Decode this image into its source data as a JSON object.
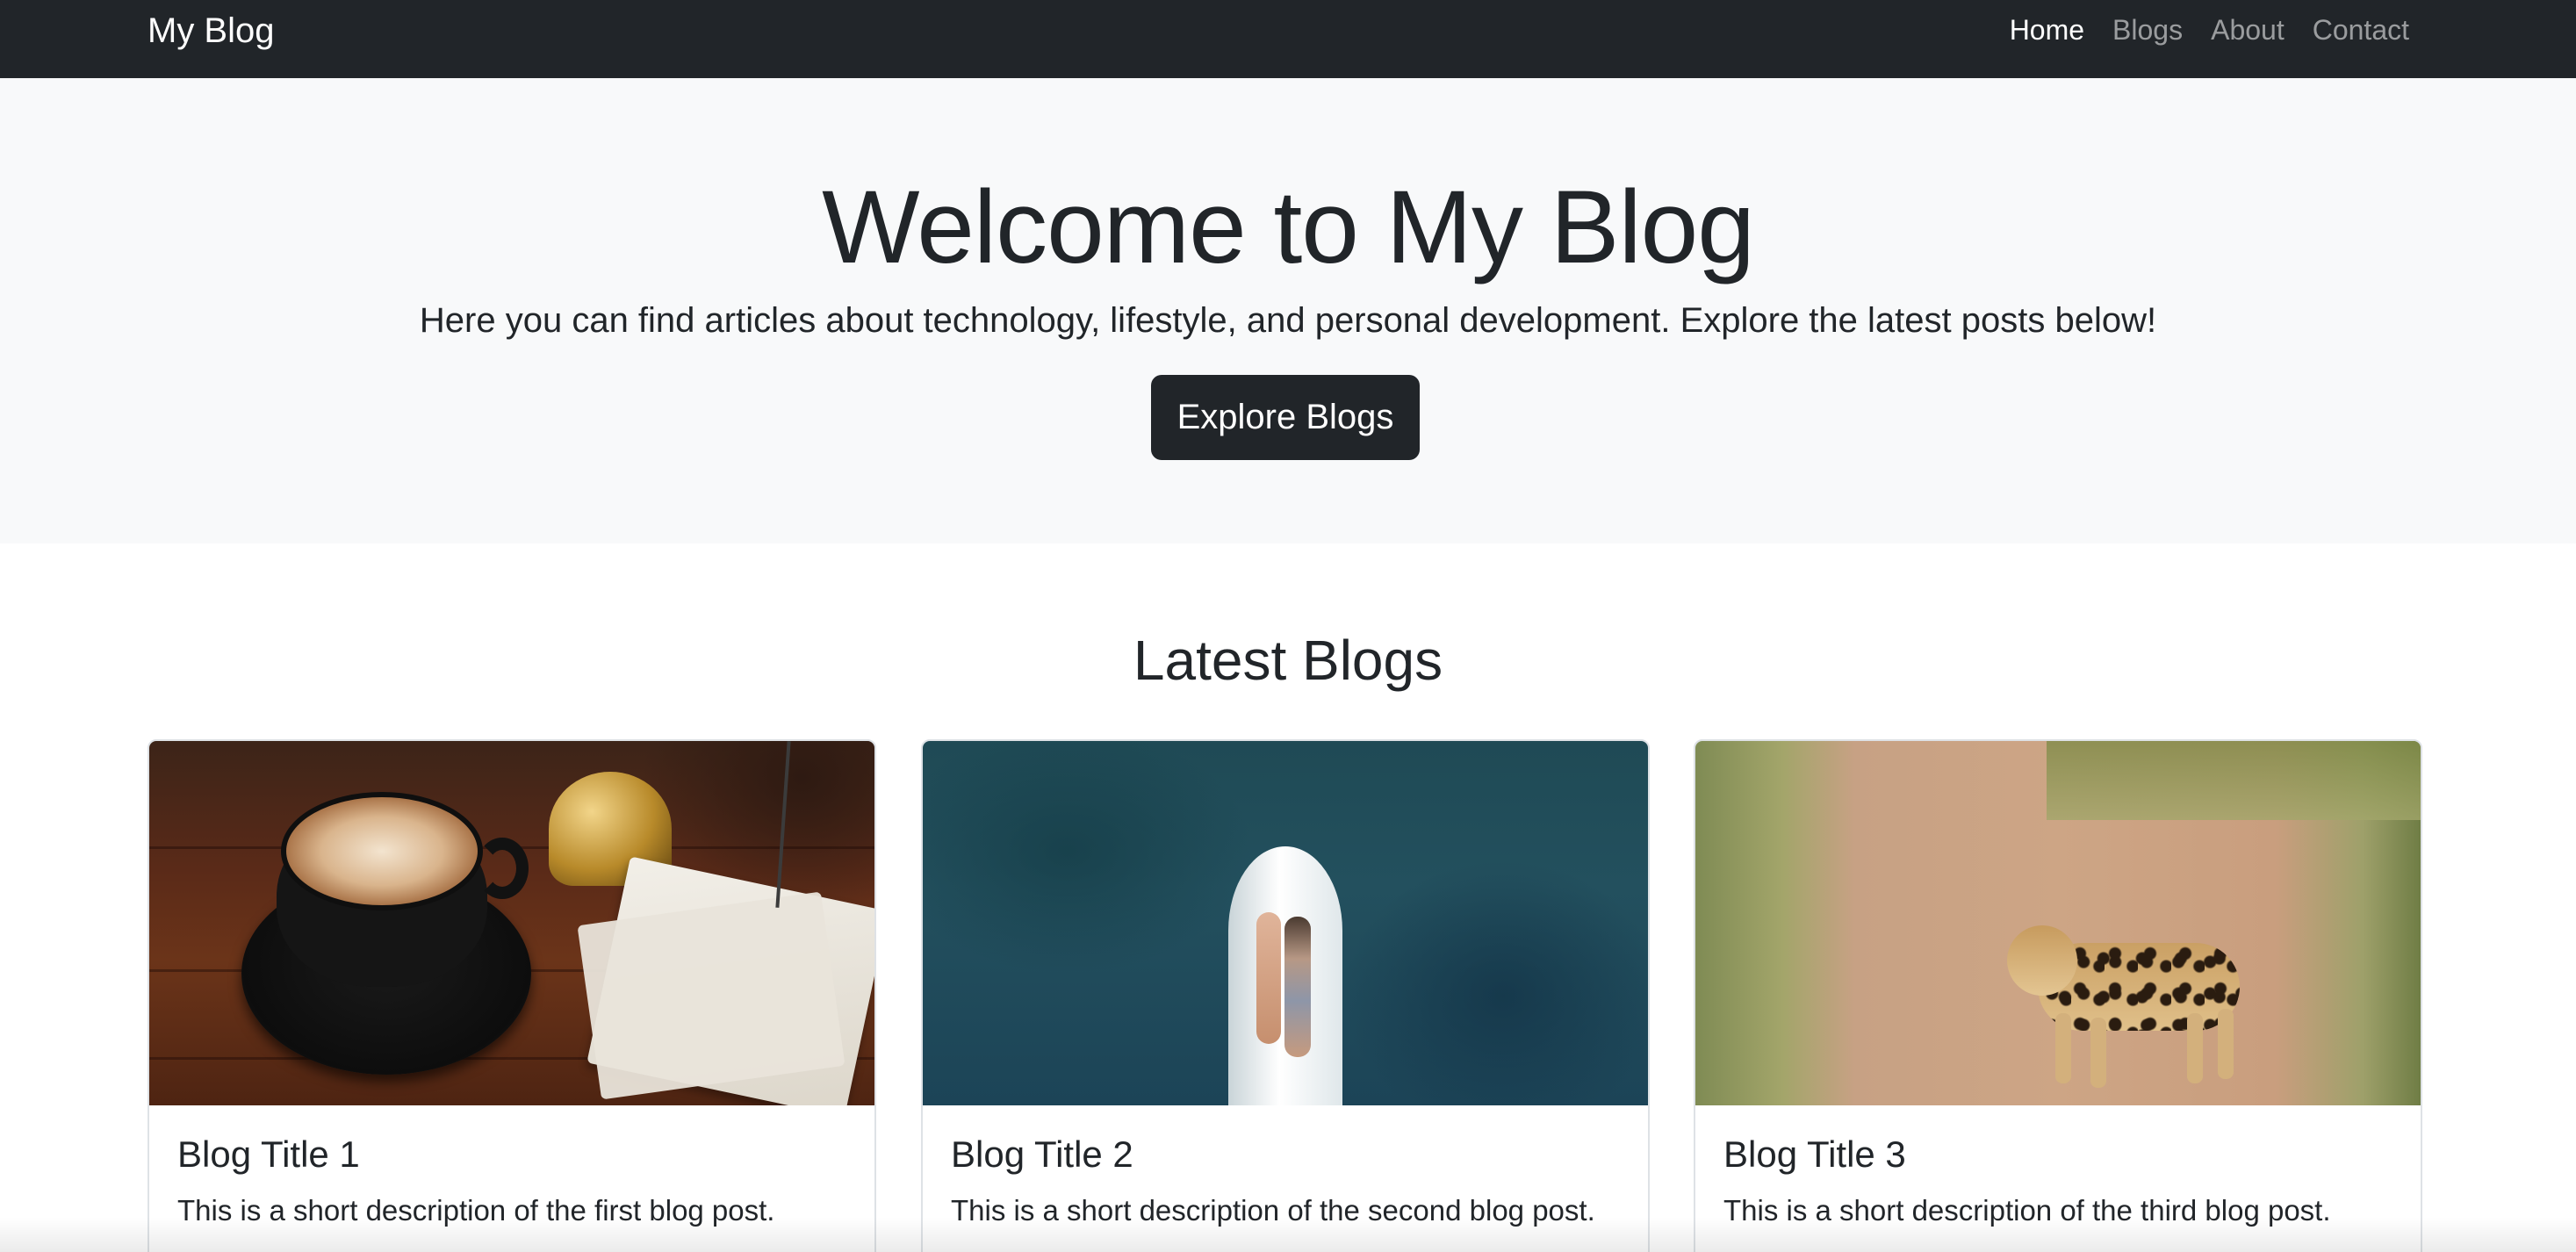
{
  "navbar": {
    "brand": "My Blog",
    "links": [
      {
        "label": "Home",
        "active": true
      },
      {
        "label": "Blogs",
        "active": false
      },
      {
        "label": "About",
        "active": false
      },
      {
        "label": "Contact",
        "active": false
      }
    ]
  },
  "hero": {
    "title": "Welcome to My Blog",
    "subtitle": "Here you can find articles about technology, lifestyle, and personal development. Explore the latest posts below!",
    "button_label": "Explore Blogs"
  },
  "latest": {
    "heading": "Latest Blogs",
    "cards": [
      {
        "title": "Blog Title 1",
        "text": "This is a short description of the first blog post."
      },
      {
        "title": "Blog Title 2",
        "text": "This is a short description of the second blog post."
      },
      {
        "title": "Blog Title 3",
        "text": "This is a short description of the third blog post."
      }
    ]
  },
  "colors": {
    "navbar_bg": "#212529",
    "hero_bg": "#f8f9fa",
    "button_bg": "#212529"
  }
}
